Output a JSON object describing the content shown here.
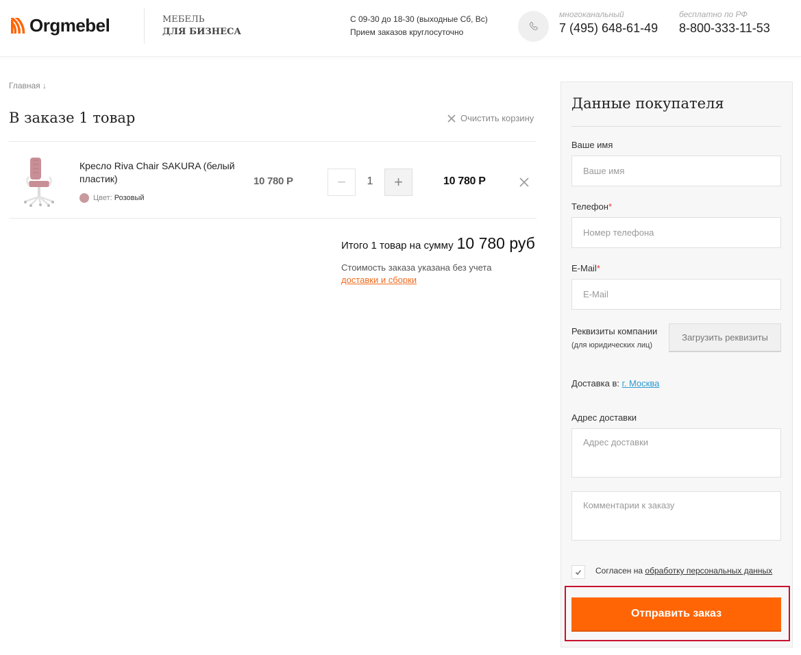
{
  "brand": {
    "logo_text": "Orgmebel",
    "tagline_line1": "МЕБЕЛЬ",
    "tagline_line2": "ДЛЯ БИЗНЕСА",
    "accent": "#ff6505"
  },
  "header": {
    "hours_line1": "С 09-30 до 18-30 (выходные Сб, Вс)",
    "hours_line2": "Прием заказов круглосуточно",
    "phone_icon": "phone-icon",
    "phones": [
      {
        "label": "многоканальный",
        "number": "7 (495) 648-61-49"
      },
      {
        "label": "бесплатно по РФ",
        "number": "8-800-333-11-53"
      }
    ]
  },
  "breadcrumb": {
    "home": "Главная",
    "arrow": "↓"
  },
  "cart": {
    "title": "В заказе 1 товар",
    "clear_label": "Очистить корзину",
    "items": [
      {
        "name": "Кресло Riva Chair SAKURA (белый пластик)",
        "color_label": "Цвет:",
        "color_value": "Розовый",
        "color_hex": "#c79a9e",
        "unit_price": "10 780 Р",
        "qty": "1",
        "total": "10 780 Р"
      }
    ],
    "qty_minus": "−",
    "qty_plus": "+",
    "summary_label": "Итого 1 товар на сумму",
    "summary_amount": "10 780 руб",
    "note_text": "Стоимость заказа указана без учета",
    "note_link": "доставки и сборки"
  },
  "form": {
    "title": "Данные покупателя",
    "name_label": "Ваше имя",
    "name_placeholder": "Ваше имя",
    "phone_label": "Телефон",
    "phone_placeholder": "Номер телефона",
    "email_label": "E-Mail",
    "email_placeholder": "E-Mail",
    "required_mark": "*",
    "company_label": "Реквизиты компании",
    "company_sub": "(для юридических лиц)",
    "upload_label": "Загрузить реквизиты",
    "delivery_label": "Доставка в:",
    "delivery_city": "г. Москва",
    "address_label": "Адрес доставки",
    "address_placeholder": "Адрес доставки",
    "comment_placeholder": "Комментарии к заказу",
    "agree_text": "Согласен на",
    "agree_link": "обработку персональных данных",
    "agree_checked": true,
    "submit_label": "Отправить заказ"
  }
}
